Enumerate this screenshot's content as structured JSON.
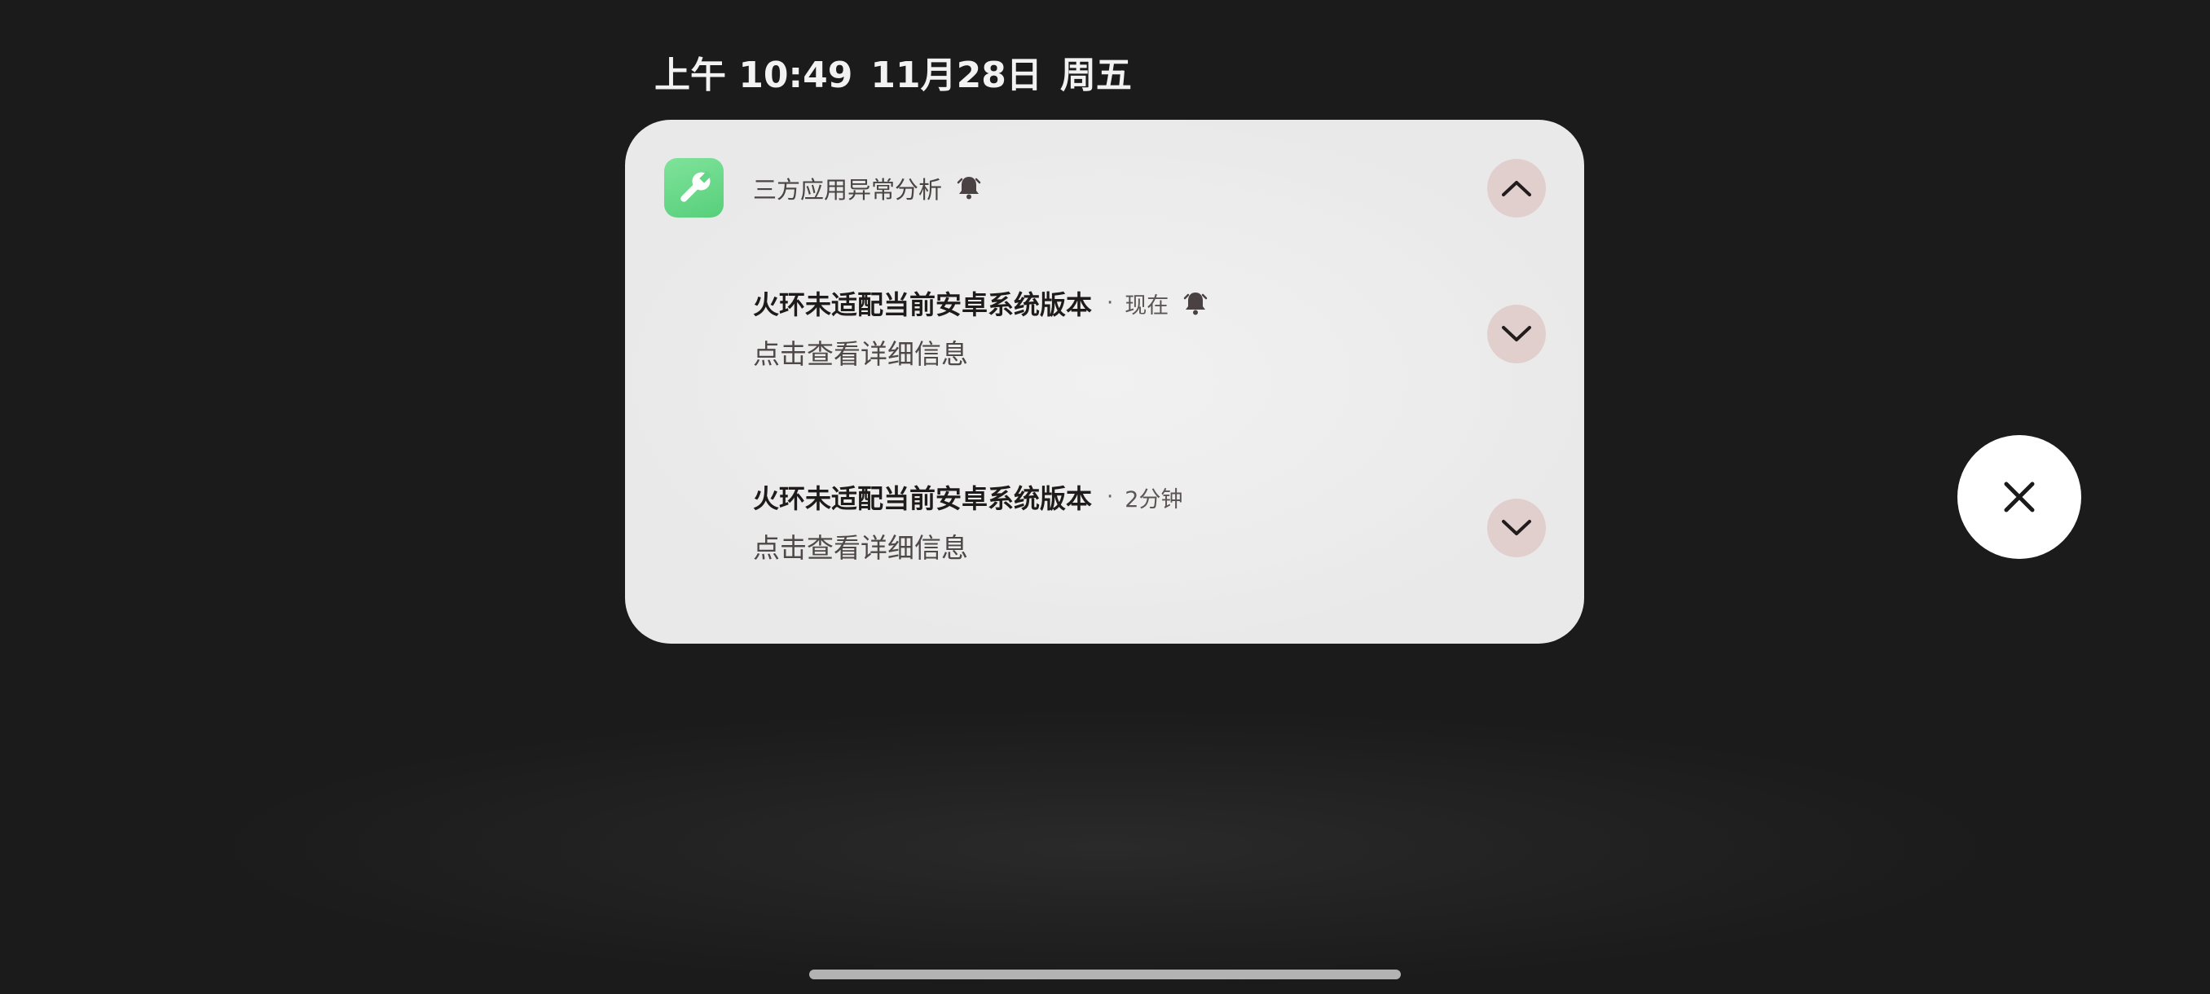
{
  "status_bar": {
    "time": "上午 10:49",
    "date": "11月28日",
    "weekday": "周五"
  },
  "notification_group": {
    "app_name": "三方应用异常分析",
    "app_icon": "wrench-icon",
    "app_icon_color": "#5fd583",
    "collapse_icon": "chevron-up-icon",
    "notifications": [
      {
        "title": "火环未适配当前安卓系统版本",
        "separator": "·",
        "time": "现在",
        "body": "点击查看详细信息",
        "has_alert_bell": true,
        "expand_icon": "chevron-down-icon"
      },
      {
        "title": "火环未适配当前安卓系统版本",
        "separator": "·",
        "time": "2分钟",
        "body": "点击查看详细信息",
        "has_alert_bell": false,
        "expand_icon": "chevron-down-icon"
      }
    ]
  },
  "clear_button": {
    "icon": "close-icon"
  },
  "colors": {
    "background": "#1c1c1c",
    "card": "#ededed",
    "button_tint": "#e1cfcd"
  }
}
